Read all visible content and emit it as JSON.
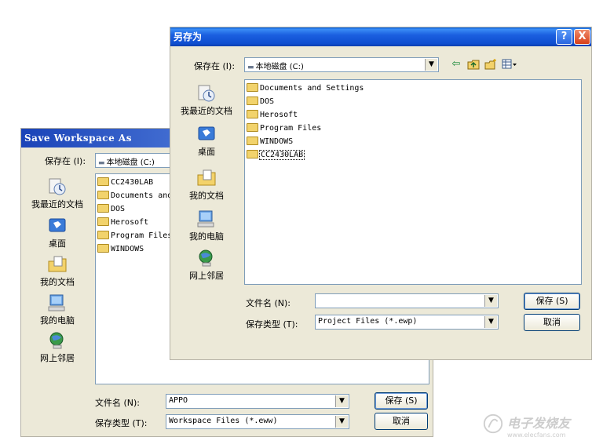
{
  "back_dialog": {
    "title": "Save Workspace As",
    "save_in_label": "保存在 (I):",
    "save_in_value": "本地磁盘 (C:)",
    "places": [
      {
        "label": "我最近的文档"
      },
      {
        "label": "桌面"
      },
      {
        "label": "我的文档"
      },
      {
        "label": "我的电脑"
      },
      {
        "label": "网上邻居"
      }
    ],
    "files": [
      "CC2430LAB",
      "Documents and",
      "DOS",
      "Herosoft",
      "Program Files",
      "WINDOWS"
    ],
    "filename_label": "文件名 (N):",
    "filename_value": "APPO",
    "filetype_label": "保存类型 (T):",
    "filetype_value": "Workspace Files (*.eww)",
    "save_button": "保存 (S)",
    "cancel_button": "取消"
  },
  "front_dialog": {
    "title": "另存为",
    "help_button": "?",
    "close_button": "X",
    "save_in_label": "保存在 (I):",
    "save_in_value": "本地磁盘 (C:)",
    "toolbar_icons": [
      "back-arrow-icon",
      "up-folder-icon",
      "new-folder-icon",
      "view-menu-icon"
    ],
    "places": [
      {
        "label": "我最近的文档"
      },
      {
        "label": "桌面"
      },
      {
        "label": "我的文档"
      },
      {
        "label": "我的电脑"
      },
      {
        "label": "网上邻居"
      }
    ],
    "files": [
      "Documents and Settings",
      "DOS",
      "Herosoft",
      "Program Files",
      "WINDOWS",
      "CC2430LAB"
    ],
    "selected_file": "CC2430LAB",
    "filename_label": "文件名 (N):",
    "filename_value": "",
    "filetype_label": "保存类型 (T):",
    "filetype_value": "Project Files (*.ewp)",
    "save_button": "保存 (S)",
    "cancel_button": "取消"
  },
  "watermark": {
    "text": "电子发烧友",
    "url": "www.elecfans.com"
  }
}
